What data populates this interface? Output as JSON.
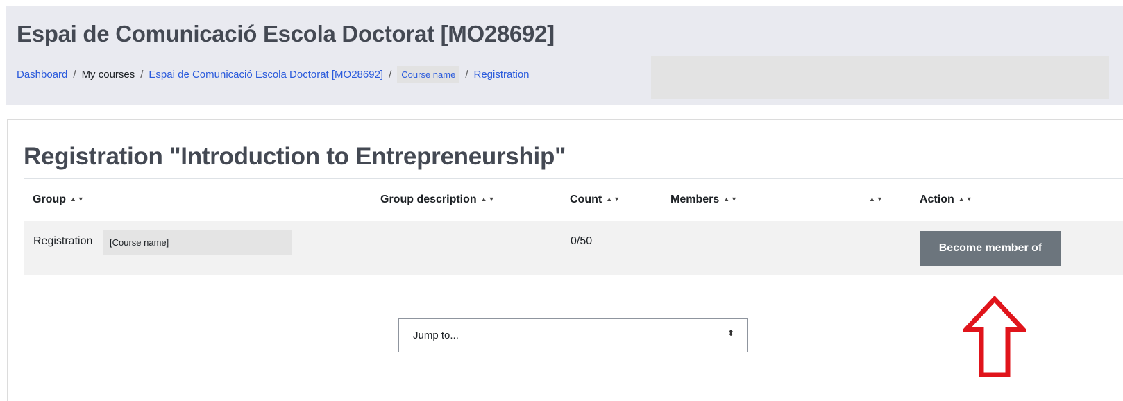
{
  "header": {
    "title": "Espai de Comunicació Escola Doctorat [MO28692]",
    "breadcrumb": [
      {
        "label": "Dashboard"
      },
      {
        "label": "My courses"
      },
      {
        "label": "Espai de Comunicació Escola Doctorat [MO28692]"
      },
      {
        "label": "Course name"
      },
      {
        "label": "Registration"
      }
    ],
    "separator": "/"
  },
  "main": {
    "title": "Registration \"Introduction to Entrepreneurship\"",
    "table": {
      "columns": [
        {
          "label": "Group",
          "sort": "▲▼"
        },
        {
          "label": "Group description",
          "sort": "▲▼"
        },
        {
          "label": "Count",
          "sort": "▲▼"
        },
        {
          "label": "Members",
          "sort": "▲▼"
        },
        {
          "label": "",
          "sort": "▲▼"
        },
        {
          "label": "Action",
          "sort": "▲▼"
        }
      ],
      "rows": [
        {
          "group": "Registration",
          "group_redacted": "[Course name]",
          "description": "",
          "count": "0/50",
          "members": "",
          "action_label": "Become member of"
        }
      ]
    },
    "jump": {
      "label": "Jump to...",
      "caret": "⬍"
    }
  },
  "colors": {
    "header_band": "#e9eaf0",
    "link": "#2b5bdc",
    "button": "#6c757d",
    "annotation": "#e0141b"
  },
  "icons": {
    "sort": "sort-arrows-icon",
    "select_caret": "chevron-updown-icon",
    "annotation": "red-up-arrow-icon"
  }
}
